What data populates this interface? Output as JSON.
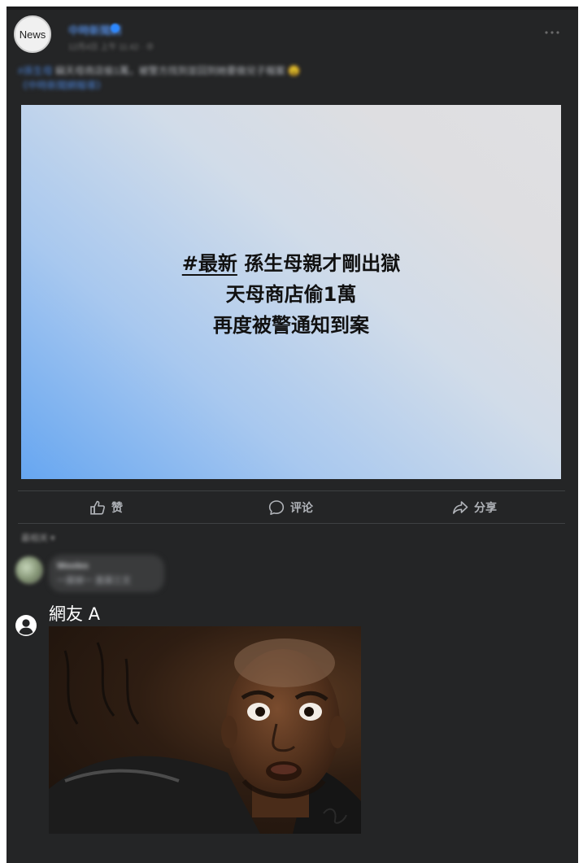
{
  "post": {
    "avatar_label": "News",
    "page_name": "中時新聞網",
    "meta": "12月4日 上午 11:42 · ⊕",
    "caption_highlight": "#孫生母",
    "caption_text": "竊天母商店偷1萬，被警方找到並回到她要做兒子報案",
    "caption_link": "《中時新聞網報導》",
    "caption_emoji": "😮"
  },
  "news_card": {
    "headline_tag": "#最新",
    "headline_line1_rest": "孫生母親才剛出獄",
    "headline_line2": "天母商店偷1萬",
    "headline_line3": "再度被警通知到案"
  },
  "actions": {
    "like_label": "赞",
    "comment_label": "评论",
    "share_label": "分享"
  },
  "comments": {
    "sort_label": "最相关 ▾",
    "blurred_comment": {
      "name": "Wooles",
      "text": "一屎掉一 直屎三文"
    },
    "reply": {
      "user_name": "網友 A",
      "reaction_image": "surprised-man-reaction-image"
    }
  },
  "colors": {
    "panel_background": "#242526",
    "divider": "#3e4042",
    "action_text": "#b0b3b8",
    "headline_text": "#111111"
  }
}
